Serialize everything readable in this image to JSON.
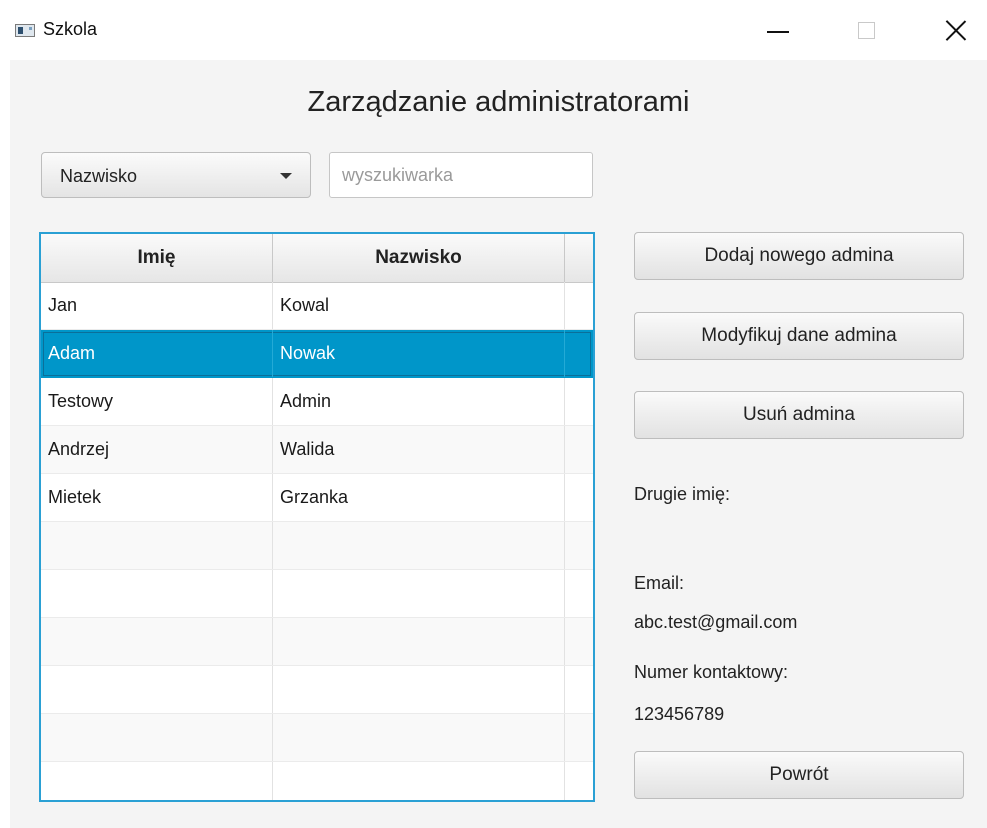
{
  "window": {
    "title": "Szkola",
    "icon": "app-window-icon"
  },
  "heading": "Zarządzanie administratorami",
  "filter": {
    "selected": "Nazwisko"
  },
  "search": {
    "placeholder": "wyszukiwarka",
    "value": ""
  },
  "table": {
    "columns": [
      "Imię",
      "Nazwisko"
    ],
    "rows": [
      {
        "imie": "Jan",
        "nazwisko": "Kowal"
      },
      {
        "imie": "Adam",
        "nazwisko": "Nowak"
      },
      {
        "imie": "Testowy",
        "nazwisko": "Admin"
      },
      {
        "imie": "Andrzej",
        "nazwisko": "Walida"
      },
      {
        "imie": "Mietek",
        "nazwisko": "Grzanka"
      }
    ],
    "selected_row": 1,
    "empty_rows": 6
  },
  "buttons": {
    "add": "Dodaj nowego admina",
    "modify": "Modyfikuj dane admina",
    "delete": "Usuń admina",
    "back": "Powrót"
  },
  "details": {
    "middle_name_label": "Drugie imię:",
    "middle_name_value": "",
    "email_label": "Email:",
    "email_value": "abc.test@gmail.com",
    "phone_label": "Numer kontaktowy:",
    "phone_value": "123456789"
  },
  "colors": {
    "selection": "#0096c9",
    "focus_border": "#2aa0d4",
    "panel_bg": "#f4f4f4"
  }
}
